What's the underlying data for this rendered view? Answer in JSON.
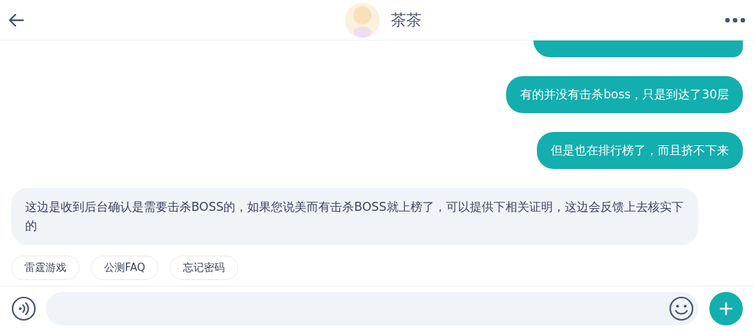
{
  "header": {
    "title": "茶茶"
  },
  "messages": [
    {
      "kind": "cut"
    },
    {
      "kind": "outgoing",
      "text": "有的并没有击杀boss，只是到达了30层"
    },
    {
      "kind": "outgoing",
      "text": "但是也在排行榜了，而且挤不下来"
    },
    {
      "kind": "incoming",
      "text": "这边是收到后台确认是需要击杀BOSS的，如果您说美而有击杀BOSS就上榜了，可以提供下相关证明，这边会反馈上去核实下的"
    }
  ],
  "quick_replies": [
    "雷霆游戏",
    "公测FAQ",
    "忘记密码"
  ]
}
